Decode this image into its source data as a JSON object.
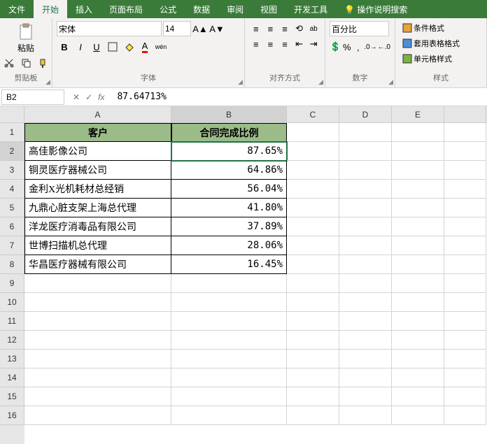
{
  "tabs": [
    "文件",
    "开始",
    "插入",
    "页面布局",
    "公式",
    "数据",
    "审阅",
    "视图",
    "开发工具"
  ],
  "activeTab": 1,
  "searchHint": "操作说明搜索",
  "ribbon": {
    "clipboard": {
      "label": "剪贴板",
      "paste": "粘贴"
    },
    "font": {
      "label": "字体",
      "name": "宋体",
      "size": "14"
    },
    "align": {
      "label": "对齐方式"
    },
    "number": {
      "label": "数字",
      "format": "百分比"
    },
    "styles": {
      "label": "样式",
      "condFmt": "条件格式",
      "tableFmt": "套用表格格式",
      "cellStyle": "单元格样式"
    }
  },
  "nameBox": "B2",
  "formulaBar": "87.64713%",
  "columns": [
    "A",
    "B",
    "C",
    "D",
    "E"
  ],
  "headers": {
    "A": "客户",
    "B": "合同完成比例"
  },
  "rows": [
    {
      "A": "高佳影像公司",
      "B": "87.65%"
    },
    {
      "A": "铜灵医疗器械公司",
      "B": "64.86%"
    },
    {
      "A": "金利X光机耗材总经销",
      "B": "56.04%"
    },
    {
      "A": "九鼎心脏支架上海总代理",
      "B": "41.80%"
    },
    {
      "A": "洋龙医疗消毒品有限公司",
      "B": "37.89%"
    },
    {
      "A": "世博扫描机总代理",
      "B": "28.06%"
    },
    {
      "A": "华昌医疗器械有限公司",
      "B": "16.45%"
    }
  ],
  "emptyRows": [
    9,
    10,
    11,
    12,
    13,
    14,
    15,
    16
  ]
}
